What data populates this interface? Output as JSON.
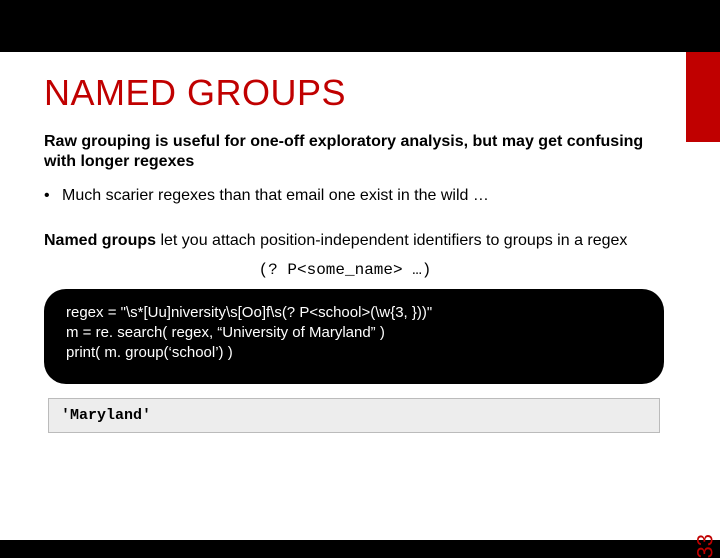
{
  "title": "NAMED GROUPS",
  "intro": "Raw grouping is useful for one-off exploratory analysis, but may get confusing with longer regexes",
  "bullet": "Much scarier regexes than that email one exist in the wild …",
  "named_lead": "Named groups",
  "named_rest": " let you attach position-independent identifiers to groups in a regex",
  "syntax": "(? P<some_name> …)",
  "code_line1": "regex = \"\\s*[Uu]niversity\\s[Oo]f\\s(? P<school>(\\w{3, }))\"",
  "code_line2": "m = re. search( regex, “University of Maryland” )",
  "code_line3": "print( m. group(‘school’) )",
  "output": "'Maryland'",
  "page": "33"
}
